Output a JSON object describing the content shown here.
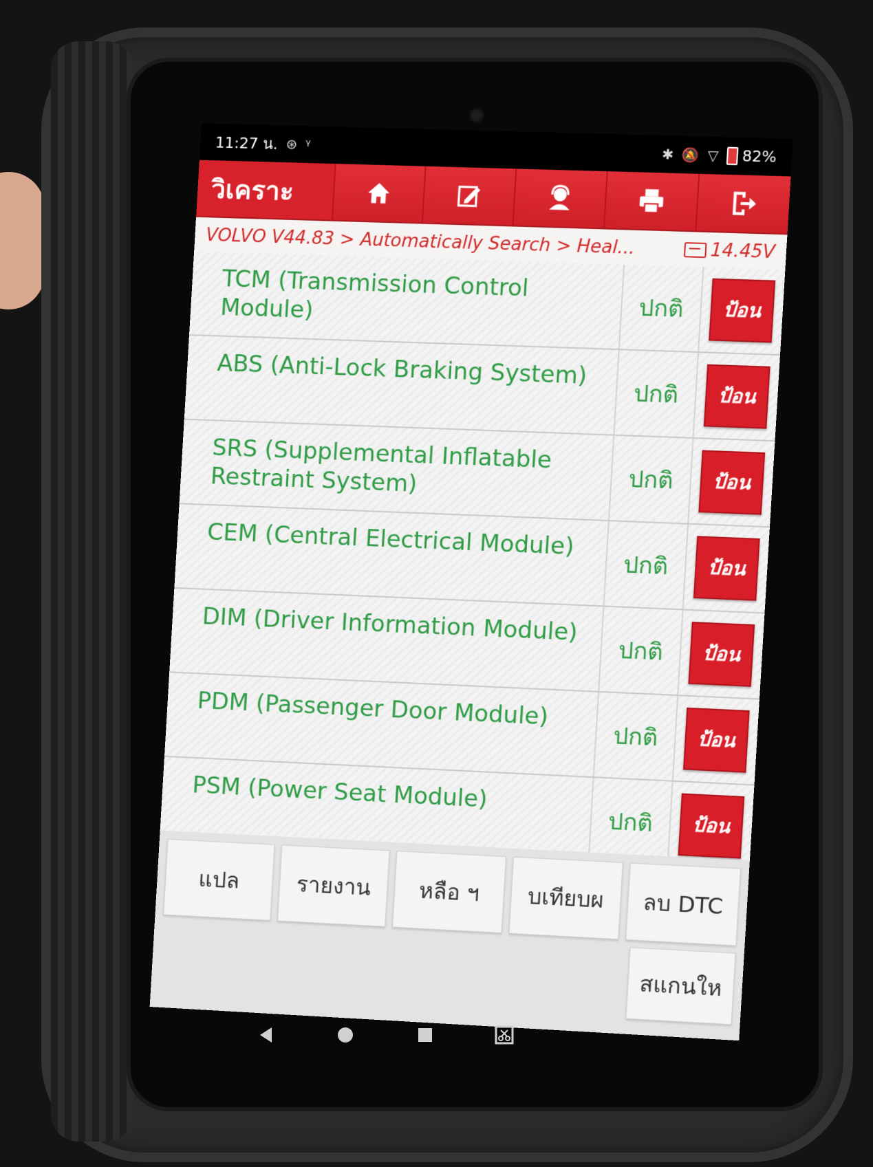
{
  "status_bar": {
    "time": "11:27 น.",
    "battery": "82%"
  },
  "toolbar": {
    "title": "วิเคราะ",
    "buttons": [
      "home-icon",
      "edit-icon",
      "support-icon",
      "print-icon",
      "exit-icon"
    ]
  },
  "breadcrumb": {
    "path": "VOLVO V44.83 > Automatically Search > Heal...",
    "voltage": "14.45V"
  },
  "modules": [
    {
      "name": "TCM (Transmission Control Module)",
      "status": "ปกติ",
      "action": "ป้อน"
    },
    {
      "name": "ABS (Anti-Lock Braking System)",
      "status": "ปกติ",
      "action": "ป้อน"
    },
    {
      "name": "SRS (Supplemental Inflatable Restraint System)",
      "status": "ปกติ",
      "action": "ป้อน"
    },
    {
      "name": "CEM (Central Electrical Module)",
      "status": "ปกติ",
      "action": "ป้อน"
    },
    {
      "name": "DIM (Driver Information Module)",
      "status": "ปกติ",
      "action": "ป้อน"
    },
    {
      "name": "PDM (Passenger Door Module)",
      "status": "ปกติ",
      "action": "ป้อน"
    },
    {
      "name": "PSM (Power Seat Module)",
      "status": "ปกติ",
      "action": "ป้อน"
    }
  ],
  "bottom_buttons": {
    "translate": "แปล",
    "report": "รายงาน",
    "help": "หลือ ฯ",
    "compare": "บเทียบผ",
    "clear_dtc": "ลบ DTC",
    "rescan": "สแกนให"
  },
  "colors": {
    "accent_red": "#d8222b",
    "status_green": "#2f9b45"
  }
}
